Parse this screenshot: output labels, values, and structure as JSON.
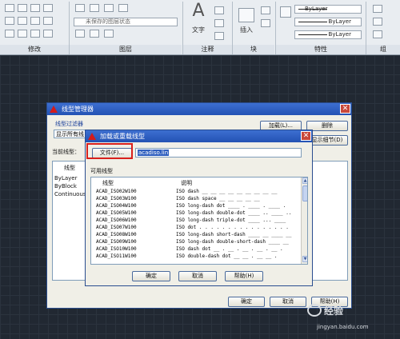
{
  "ribbon": {
    "panels": [
      {
        "title": "修改"
      },
      {
        "title": "图层"
      },
      {
        "title": "注释"
      },
      {
        "title": "块"
      },
      {
        "title": "特性"
      },
      {
        "title": "组"
      }
    ],
    "layer_state_placeholder": "未保存的图层状态",
    "text_button_label": "文字",
    "insert_button_label": "插入",
    "color_combo": "ByLayer",
    "linetype_combo": "ByLayer",
    "lineweight_combo": "ByLayer"
  },
  "linetype_manager": {
    "title": "线型管理器",
    "filter_label": "线型过滤器",
    "filter_value": "显示所有线",
    "load_label": "加载(L)...",
    "delete_label": "删除",
    "details_label": "显示细节(D)",
    "current_label": "当前线型：",
    "list_header": "线型",
    "entries": [
      "ByLayer",
      "ByBlock",
      "Continuous"
    ],
    "ok_label": "确定",
    "cancel_label": "取消",
    "help_label": "帮助(H)"
  },
  "load_dialog": {
    "title": "加载或重载线型",
    "file_button_label": "文件(F)...",
    "file_value": "acadiso.lin",
    "available_label": "可用线型",
    "col_linetype": "线型",
    "col_desc": "说明",
    "rows": [
      {
        "name": "ACAD_ISO02W100",
        "desc": "ISO dash __ __ __ __ __ __ __ __ __"
      },
      {
        "name": "ACAD_ISO03W100",
        "desc": "ISO dash space __   __   __   __   __"
      },
      {
        "name": "ACAD_ISO04W100",
        "desc": "ISO long-dash dot ____ . ____ . ____ ."
      },
      {
        "name": "ACAD_ISO05W100",
        "desc": "ISO long-dash double-dot ____ .. ____ .."
      },
      {
        "name": "ACAD_ISO06W100",
        "desc": "ISO long-dash triple-dot ____ ... ____"
      },
      {
        "name": "ACAD_ISO07W100",
        "desc": "ISO dot . . . . . . . . . . . . . . . ."
      },
      {
        "name": "ACAD_ISO08W100",
        "desc": "ISO long-dash short-dash ____ __ ____ __"
      },
      {
        "name": "ACAD_ISO09W100",
        "desc": "ISO long-dash double-short-dash ____ __"
      },
      {
        "name": "ACAD_ISO10W100",
        "desc": "ISO dash dot __ . __ . __ . __ . __ ."
      },
      {
        "name": "ACAD_ISO11W100",
        "desc": "ISO double-dash dot __ __ . __ __ ."
      }
    ],
    "ok_label": "确定",
    "cancel_label": "取消",
    "help_label": "帮助(H)"
  },
  "colors": {
    "highlight_red": "#d9201c",
    "titlebar_blue": "#2352b4",
    "canvas": "#212832"
  },
  "watermark": {
    "text": "经验",
    "url": "jingyan.baidu.com"
  }
}
